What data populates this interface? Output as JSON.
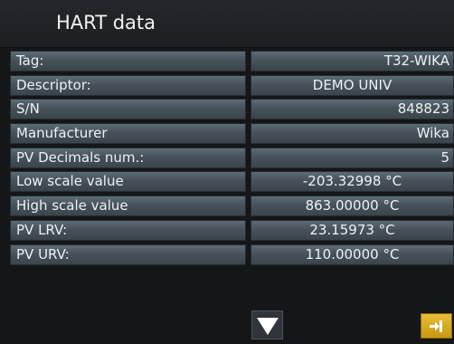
{
  "header": {
    "title": "HART data"
  },
  "rows": [
    {
      "label": "Tag:",
      "value": "T32-WIKA",
      "align": "right"
    },
    {
      "label": "Descriptor:",
      "value": "DEMO UNIV",
      "align": "center"
    },
    {
      "label": "S/N",
      "value": "848823",
      "align": "right"
    },
    {
      "label": "Manufacturer",
      "value": "Wika",
      "align": "right"
    },
    {
      "label": "PV Decimals num.:",
      "value": "5",
      "align": "right"
    },
    {
      "label": "Low scale value",
      "value": "-203.32998 °C",
      "align": "center"
    },
    {
      "label": "High scale value",
      "value": "863.00000 °C",
      "align": "center"
    },
    {
      "label": "PV LRV:",
      "value": "23.15973 °C",
      "align": "center"
    },
    {
      "label": "PV URV:",
      "value": "110.00000 °C",
      "align": "center"
    }
  ],
  "footer": {
    "scroll_down_icon": "triangle-down-icon",
    "exit_icon": "exit-arrow-icon"
  },
  "colors": {
    "header_bg": "#1f2326",
    "cell_top": "#5d6b74",
    "cell_bottom": "#3a444b",
    "exit_button": "#d9a820",
    "text": "#eef1f3"
  }
}
